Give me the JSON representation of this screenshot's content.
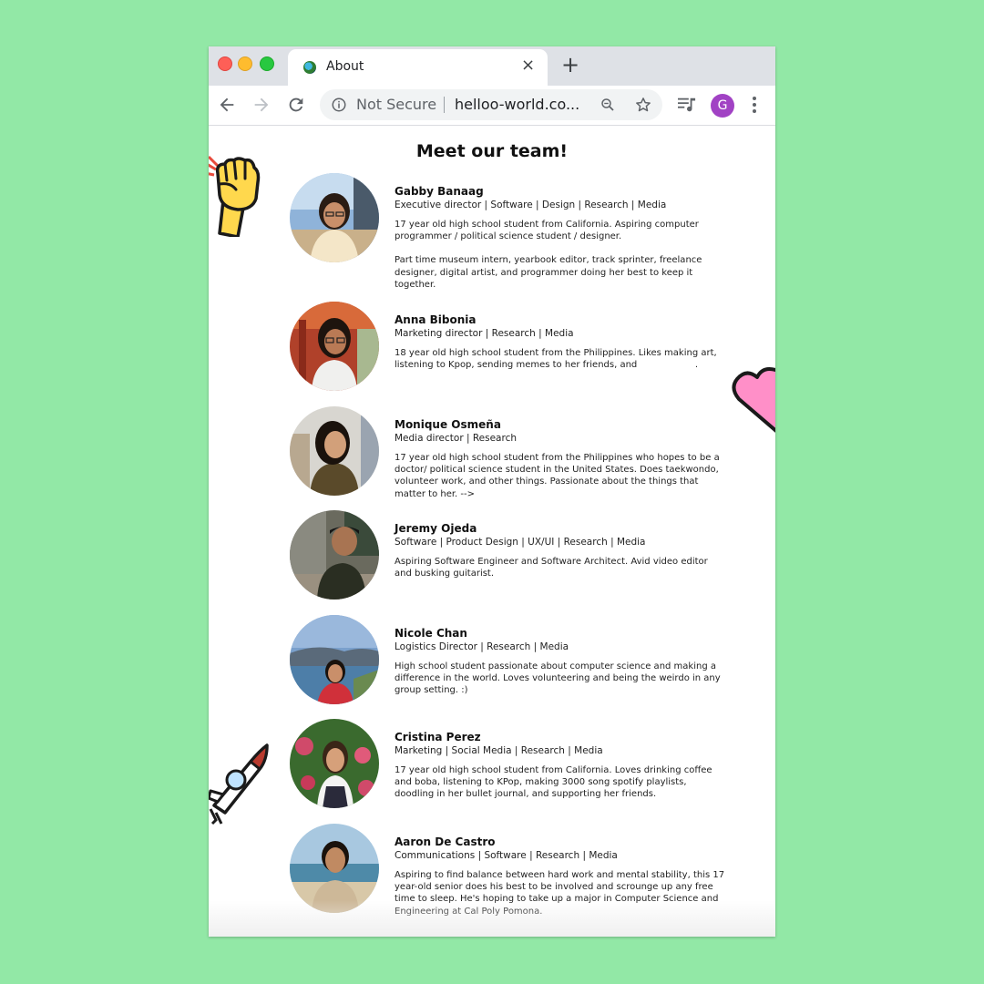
{
  "browser": {
    "tab_title": "About",
    "tab_close": "×",
    "new_tab": "+",
    "security_label": "Not Secure",
    "url": "helloo-world.co...",
    "profile_initial": "G"
  },
  "page": {
    "title": "Meet our team!",
    "members": [
      {
        "name": "Gabby Banaag",
        "roles": "Executive director | Software | Design | Research | Media",
        "bio": "17 year old high school student from California. Aspiring computer programmer / political science student / designer.",
        "bio_extra": "Part time museum intern, yearbook editor, track sprinter, freelance designer, digital artist, and programmer doing her best to keep it together."
      },
      {
        "name": "Anna Bibonia",
        "roles": "Marketing director | Research | Media",
        "bio": "18 year old high school student from the Philippines. Likes making art, listening to Kpop, sending memes to her friends, and                    ."
      },
      {
        "name": "Monique Osmeña",
        "roles": "Media director | Research",
        "bio": "17 year old high school student from the Philippines who hopes to be a doctor/ political science student in the United States. Does taekwondo, volunteer work, and other things. Passionate about the things that matter to her. -->"
      },
      {
        "name": "Jeremy Ojeda",
        "roles": "Software | Product Design | UX/UI | Research | Media",
        "bio": "Aspiring Software Engineer and Software Architect. Avid video editor and busking guitarist."
      },
      {
        "name": "Nicole Chan",
        "roles": "Logistics Director | Research | Media",
        "bio": "High school student passionate about computer science and making a difference in the world. Loves volunteering and being the weirdo in any group setting. :)"
      },
      {
        "name": "Cristina Perez",
        "roles": "Marketing | Social Media | Research | Media",
        "bio": "17 year old high school student from California. Loves drinking coffee and boba, listening to KPop, making 3000 song spotify playlists, doodling in her bullet journal, and supporting her friends."
      },
      {
        "name": "Aaron De Castro",
        "roles": "Communications | Software | Research | Media",
        "bio": "Aspiring to find balance between hard work and mental stability, this 17 year-old senior does his best to be involved and scrounge up any free time to sleep. He's hoping to take up a major in Computer Science and Engineering at Cal Poly Pomona."
      }
    ]
  },
  "colors": {
    "background": "#92e8a6",
    "avatar": "#a142c4",
    "heart": "#ff8fc8",
    "fist": "#ffd84d"
  },
  "icons": [
    "back-arrow-icon",
    "forward-arrow-icon",
    "reload-icon",
    "info-icon",
    "zoom-icon",
    "star-icon",
    "media-control-icon",
    "kebab-menu-icon",
    "fist-sticker",
    "heart-sticker",
    "rocket-sticker"
  ]
}
